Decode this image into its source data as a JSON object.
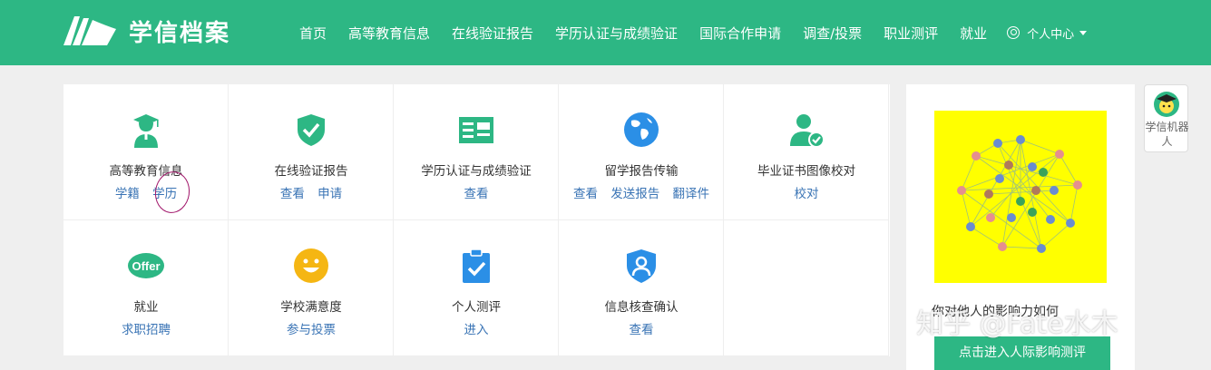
{
  "brand": {
    "name": "学信档案"
  },
  "nav": {
    "items": [
      "首页",
      "高等教育信息",
      "在线验证报告",
      "学历认证与成绩验证",
      "国际合作申请",
      "调查/投票",
      "职业测评",
      "就业"
    ],
    "user_label": "个人中心"
  },
  "services": [
    {
      "title": "高等教育信息",
      "links": [
        "学籍",
        "学历"
      ]
    },
    {
      "title": "在线验证报告",
      "links": [
        "查看",
        "申请"
      ]
    },
    {
      "title": "学历认证与成绩验证",
      "links": [
        "查看"
      ]
    },
    {
      "title": "留学报告传输",
      "links": [
        "查看",
        "发送报告",
        "翻译件"
      ]
    },
    {
      "title": "毕业证书图像校对",
      "links": [
        "校对"
      ]
    },
    {
      "title": "就业",
      "links": [
        "求职招聘"
      ],
      "badge": "Offer"
    },
    {
      "title": "学校满意度",
      "links": [
        "参与投票"
      ]
    },
    {
      "title": "个人测评",
      "links": [
        "进入"
      ]
    },
    {
      "title": "信息核查确认",
      "links": [
        "查看"
      ]
    }
  ],
  "ad": {
    "caption": "你对他人的影响力如何",
    "button": "点击进入人际影响测评"
  },
  "robot": {
    "label": "学信机器人"
  },
  "watermark": "知乎 @Fate水木",
  "colors": {
    "brand": "#2db784",
    "link": "#3a74b5",
    "annotation": "#a01469",
    "ad_bg": "#ffff00"
  }
}
